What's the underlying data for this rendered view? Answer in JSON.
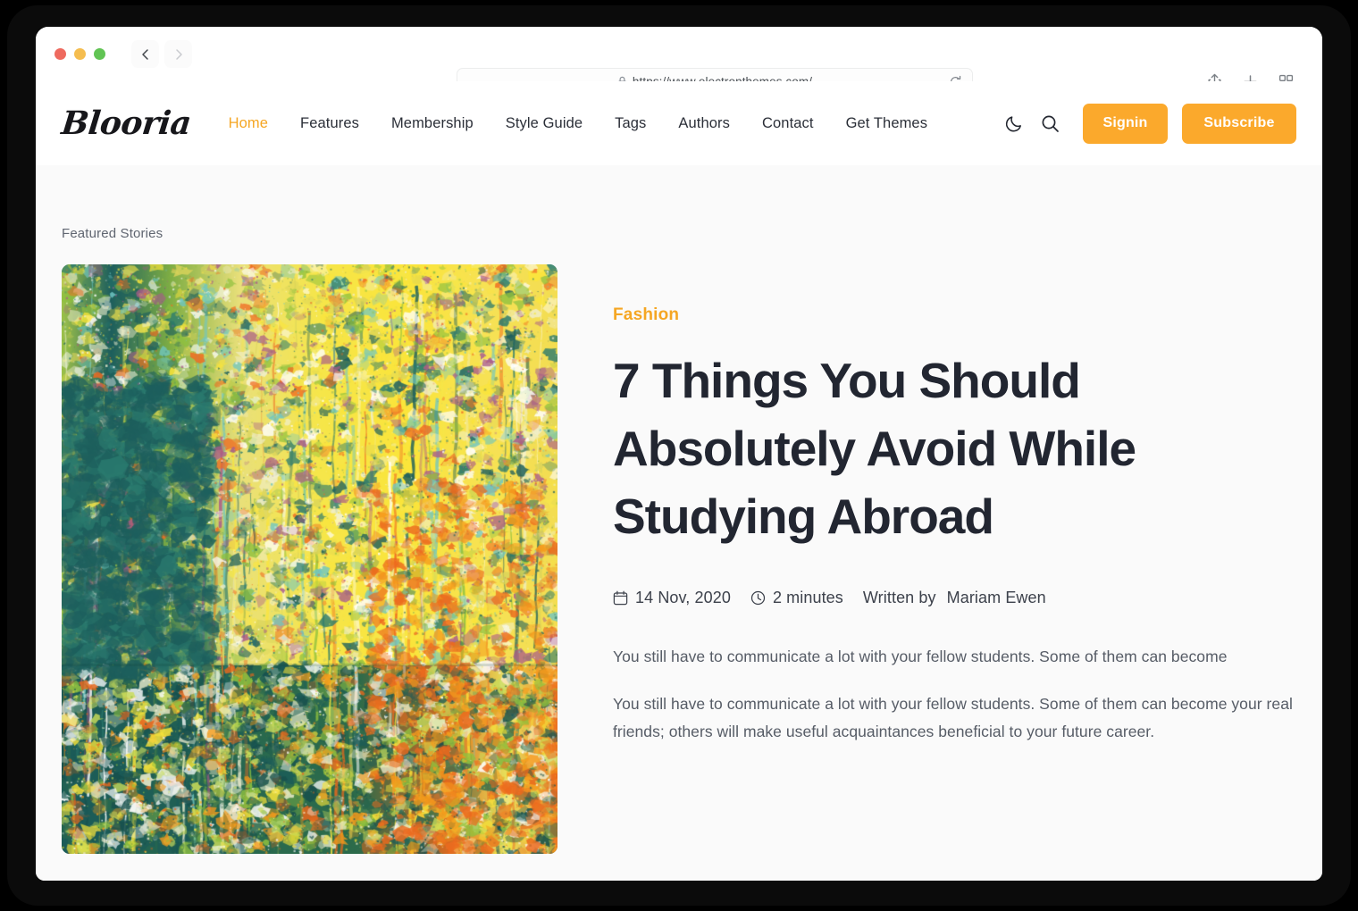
{
  "browser": {
    "traffic_lights": [
      "close",
      "minimize",
      "maximize"
    ],
    "back_label": "Back",
    "forward_label": "Forward",
    "url": "https://www.electronthemes.com/",
    "lock_icon": "lock-icon",
    "reload_icon": "reload-icon",
    "share_icon": "share-icon",
    "new_tab_icon": "plus-icon",
    "tabs_overview_icon": "tab-grid-icon"
  },
  "site": {
    "logo": "Blooria",
    "nav": [
      {
        "label": "Home",
        "active": true
      },
      {
        "label": "Features",
        "active": false
      },
      {
        "label": "Membership",
        "active": false
      },
      {
        "label": "Style Guide",
        "active": false
      },
      {
        "label": "Tags",
        "active": false
      },
      {
        "label": "Authors",
        "active": false
      },
      {
        "label": "Contact",
        "active": false
      },
      {
        "label": "Get Themes",
        "active": false
      }
    ],
    "dark_mode_icon": "moon-icon",
    "search_icon": "search-icon",
    "signin_label": "Signin",
    "subscribe_label": "Subscribe",
    "accent_color": "#fba92c",
    "link_active_color": "#f5a623"
  },
  "main": {
    "section_label": "Featured Stories",
    "featured": {
      "image_alt": "Abstract yellow, teal and orange paint splatter artwork",
      "category": "Fashion",
      "title": "7 Things You Should Absolutely Avoid While Studying Abroad",
      "date": "14 Nov, 2020",
      "date_icon": "calendar-icon",
      "read_time": "2 minutes",
      "read_time_icon": "clock-icon",
      "written_by_label": "Written by",
      "author": "Mariam Ewen",
      "excerpt_1": "You still have to communicate a lot with your fellow students. Some of them can become",
      "excerpt_2": "You still have to communicate a lot with your fellow students. Some of them can become your real friends; others will make useful acquaintances beneficial to your future career."
    }
  }
}
